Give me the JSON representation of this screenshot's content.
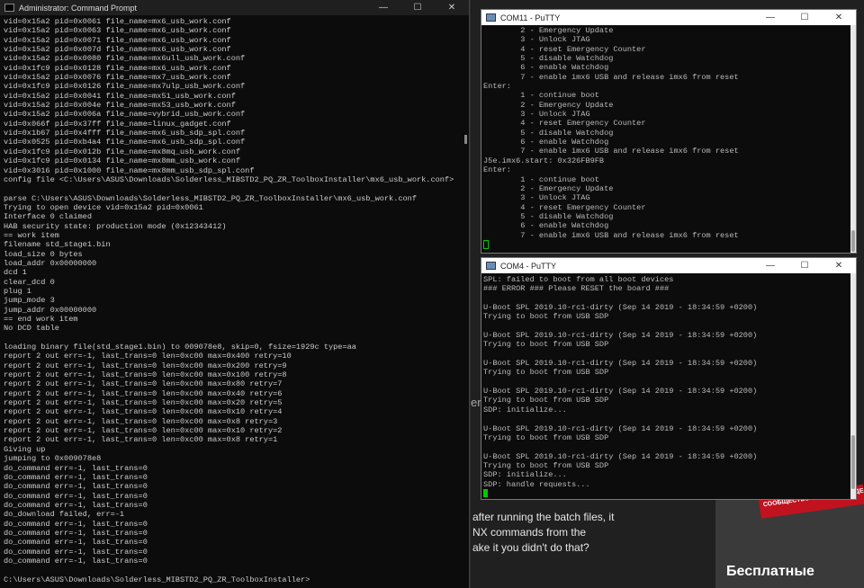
{
  "cmd_window": {
    "title": "Administrator: Command Prompt",
    "controls": {
      "minimize": "—",
      "maximize": "☐",
      "close": "✕"
    },
    "lines": [
      "vid=0x15a2 pid=0x0061 file_name=mx6_usb_work.conf",
      "vid=0x15a2 pid=0x0063 file_name=mx6_usb_work.conf",
      "vid=0x15a2 pid=0x0071 file_name=mx6_usb_work.conf",
      "vid=0x15a2 pid=0x007d file_name=mx6_usb_work.conf",
      "vid=0x15a2 pid=0x0080 file_name=mx6ull_usb_work.conf",
      "vid=0x1fc9 pid=0x0128 file_name=mx6_usb_work.conf",
      "vid=0x15a2 pid=0x0076 file_name=mx7_usb_work.conf",
      "vid=0x1fc9 pid=0x0126 file_name=mx7ulp_usb_work.conf",
      "vid=0x15a2 pid=0x0041 file_name=mx51_usb_work.conf",
      "vid=0x15a2 pid=0x004e file_name=mx53_usb_work.conf",
      "vid=0x15a2 pid=0x006a file_name=vybrid_usb_work.conf",
      "vid=0x066f pid=0x37ff file_name=linux_gadget.conf",
      "vid=0x1b67 pid=0x4fff file_name=mx6_usb_sdp_spl.conf",
      "vid=0x0525 pid=0xb4a4 file_name=mx6_usb_sdp_spl.conf",
      "vid=0x1fc9 pid=0x012b file_name=mx8mq_usb_work.conf",
      "vid=0x1fc9 pid=0x0134 file_name=mx8mm_usb_work.conf",
      "vid=0x3016 pid=0x1000 file_name=mx8mm_usb_sdp_spl.conf",
      "config file <C:\\Users\\ASUS\\Downloads\\Solderless_MIBSTD2_PQ_ZR_ToolboxInstaller\\mx6_usb_work.conf>",
      "",
      "parse C:\\Users\\ASUS\\Downloads\\Solderless_MIBSTD2_PQ_ZR_ToolboxInstaller\\mx6_usb_work.conf",
      "Trying to open device vid=0x15a2 pid=0x0061",
      "Interface 0 claimed",
      "HAB security state: production mode (0x12343412)",
      "== work item",
      "filename std_stage1.bin",
      "load_size 0 bytes",
      "load_addr 0x00000000",
      "dcd 1",
      "clear_dcd 0",
      "plug 1",
      "jump_mode 3",
      "jump_addr 0x00000000",
      "== end work item",
      "No DCD table",
      "",
      "loading binary file(std_stage1.bin) to 009078e8, skip=0, fsize=1929c type=aa",
      "report 2 out err=-1, last_trans=0 len=0xc00 max=0x400 retry=10",
      "report 2 out err=-1, last_trans=0 len=0xc00 max=0x200 retry=9",
      "report 2 out err=-1, last_trans=0 len=0xc00 max=0x100 retry=8",
      "report 2 out err=-1, last_trans=0 len=0xc00 max=0x80 retry=7",
      "report 2 out err=-1, last_trans=0 len=0xc00 max=0x40 retry=6",
      "report 2 out err=-1, last_trans=0 len=0xc00 max=0x20 retry=5",
      "report 2 out err=-1, last_trans=0 len=0xc00 max=0x10 retry=4",
      "report 2 out err=-1, last_trans=0 len=0xc00 max=0x8 retry=3",
      "report 2 out err=-1, last_trans=0 len=0xc00 max=0x10 retry=2",
      "report 2 out err=-1, last_trans=0 len=0xc00 max=0x8 retry=1",
      "Giving up",
      "jumping to 0x009078e8",
      "do_command err=-1, last_trans=0",
      "do_command err=-1, last_trans=0",
      "do_command err=-1, last_trans=0",
      "do_command err=-1, last_trans=0",
      "do_command err=-1, last_trans=0",
      "do_download failed, err=-1",
      "do_command err=-1, last_trans=0",
      "do_command err=-1, last_trans=0",
      "do_command err=-1, last_trans=0",
      "do_command err=-1, last_trans=0",
      "do_command err=-1, last_trans=0",
      "",
      "C:\\Users\\ASUS\\Downloads\\Solderless_MIBSTD2_PQ_ZR_ToolboxInstaller>"
    ]
  },
  "com11_window": {
    "title": "COM11 - PuTTY",
    "controls": {
      "minimize": "—",
      "maximize": "☐",
      "close": "✕"
    },
    "lines": [
      "        2 - Emergency Update",
      "        3 - Unlock JTAG",
      "        4 - reset Emergency Counter",
      "        5 - disable Watchdog",
      "        6 - enable Watchdog",
      "        7 - enable imx6 USB and release imx6 from reset",
      "Enter:",
      "        1 - continue boot",
      "        2 - Emergency Update",
      "        3 - Unlock JTAG",
      "        4 - reset Emergency Counter",
      "        5 - disable Watchdog",
      "        6 - enable Watchdog",
      "        7 - enable imx6 USB and release imx6 from reset",
      "J5e.imx6.start: 0x326FB9FB",
      "Enter:",
      "        1 - continue boot",
      "        2 - Emergency Update",
      "        3 - Unlock JTAG",
      "        4 - reset Emergency Counter",
      "        5 - disable Watchdog",
      "        6 - enable Watchdog",
      "        7 - enable imx6 USB and release imx6 from reset"
    ]
  },
  "com4_window": {
    "title": "COM4 - PuTTY",
    "controls": {
      "minimize": "—",
      "maximize": "☐",
      "close": "✕"
    },
    "lines": [
      "SPL: failed to boot from all boot devices",
      "### ERROR ### Please RESET the board ###",
      "",
      "U-Boot SPL 2019.10-rc1-dirty (Sep 14 2019 - 18:34:59 +0200)",
      "Trying to boot from USB SDP",
      "",
      "U-Boot SPL 2019.10-rc1-dirty (Sep 14 2019 - 18:34:59 +0200)",
      "Trying to boot from USB SDP",
      "",
      "U-Boot SPL 2019.10-rc1-dirty (Sep 14 2019 - 18:34:59 +0200)",
      "Trying to boot from USB SDP",
      "",
      "U-Boot SPL 2019.10-rc1-dirty (Sep 14 2019 - 18:34:59 +0200)",
      "Trying to boot from USB SDP",
      "SDP: initialize...",
      "",
      "U-Boot SPL 2019.10-rc1-dirty (Sep 14 2019 - 18:34:59 +0200)",
      "Trying to boot from USB SDP",
      "",
      "U-Boot SPL 2019.10-rc1-dirty (Sep 14 2019 - 18:34:59 +0200)",
      "Trying to boot from USB SDP",
      "SDP: initialize...",
      "SDP: handle requests..."
    ]
  },
  "background_page": {
    "cut_text": "er",
    "lines": [
      "after running the batch files, it",
      "NX commands from the",
      "ake it you didn't do that?"
    ],
    "banner_strip": "СООБЩЕСТВО МАШИН И ЛЮДЕЙ",
    "banner_heading": "Бесплатные"
  },
  "colors": {
    "terminal_bg": "#0c0c0c",
    "terminal_text": "#cccccc",
    "cursor": "#00c800"
  }
}
